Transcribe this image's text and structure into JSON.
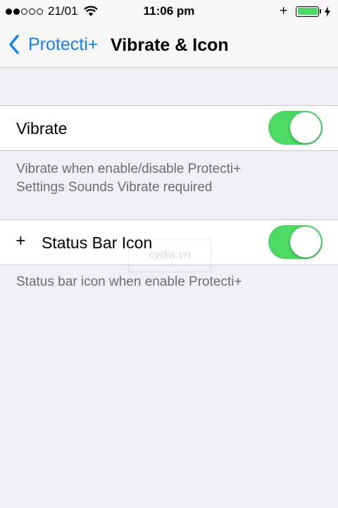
{
  "status_bar": {
    "signal_dots": [
      "full",
      "full",
      "empty",
      "empty",
      "empty"
    ],
    "carrier": "21/01",
    "time": "11:06 pm",
    "tweak_glyph": "+",
    "battery_level": 1.0,
    "icons": [
      "wifi-icon",
      "battery-icon",
      "charging-bolt-icon"
    ]
  },
  "nav": {
    "back_label": "Protecti+",
    "title": "Vibrate & Icon"
  },
  "settings": [
    {
      "label": "Vibrate",
      "enabled": true,
      "footer_lines": [
        "Vibrate when enable/disable Protecti+",
        "Settings Sounds Vibrate required"
      ]
    },
    {
      "icon_glyph": "+",
      "label": "Status Bar Icon",
      "enabled": true,
      "footer_lines": [
        "Status bar icon when enable Protecti+"
      ]
    }
  ],
  "watermark": "cydia.vn",
  "colors": {
    "accent": "#1a7ff0",
    "toggle_on": "#4cd964",
    "background": "#efeff4",
    "footer_text": "#6d6d72"
  }
}
